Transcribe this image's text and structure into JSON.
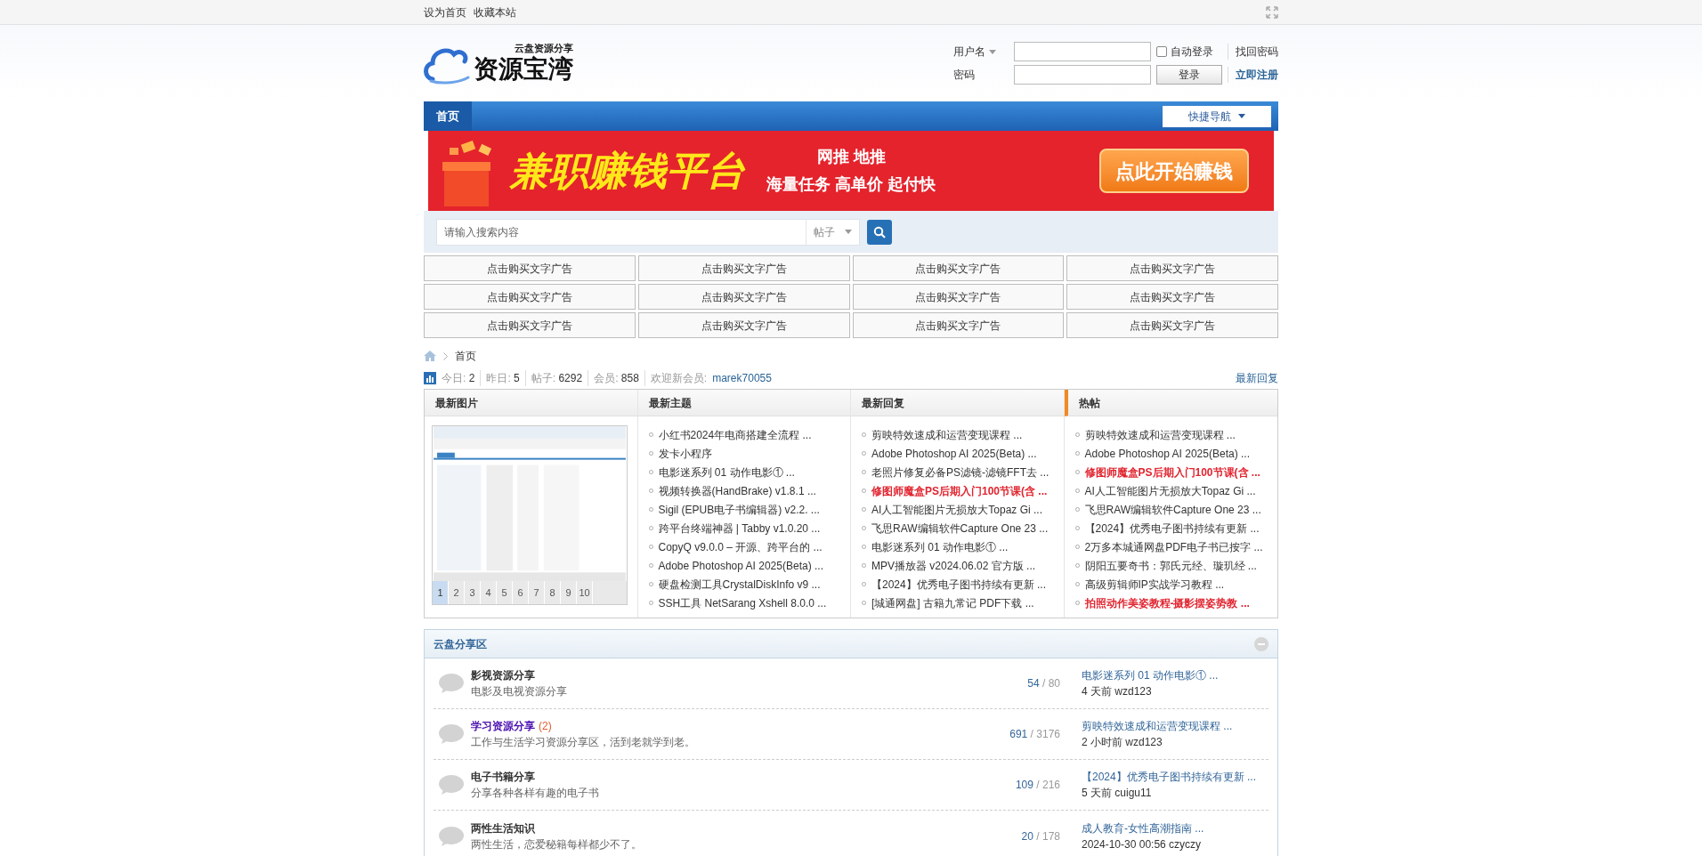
{
  "top_bar": {
    "links": [
      "设为首页",
      "收藏本站"
    ]
  },
  "logo": {
    "name": "资源宝湾",
    "tagline": "云盘资源分享"
  },
  "login": {
    "username_label": "用户名",
    "password_label": "密码",
    "remember": {
      "label": "自动登录",
      "checked": false
    },
    "submit": "登录",
    "forgot": "找回密码",
    "register": "立即注册"
  },
  "nav": {
    "tabs": [
      {
        "label": "首页",
        "selected": true
      }
    ],
    "quick_nav": "快捷导航"
  },
  "banner": {
    "headline": "兼职赚钱平台",
    "line1": "网推 地推",
    "line2": "海量任务 高单价 起付快",
    "cta": "点此开始赚钱"
  },
  "search": {
    "placeholder": "请输入搜索内容",
    "scope": "帖子"
  },
  "text_ads": [
    "点击购买文字广告",
    "点击购买文字广告",
    "点击购买文字广告",
    "点击购买文字广告",
    "点击购买文字广告",
    "点击购买文字广告",
    "点击购买文字广告",
    "点击购买文字广告",
    "点击购买文字广告",
    "点击购买文字广告",
    "点击购买文字广告",
    "点击购买文字广告"
  ],
  "breadcrumb": [
    "首页"
  ],
  "stats": {
    "items": [
      {
        "label": "今日:",
        "value": "2"
      },
      {
        "label": "昨日:",
        "value": "5"
      },
      {
        "label": "帖子:",
        "value": "6292"
      },
      {
        "label": "会员:",
        "value": "858"
      }
    ],
    "welcome_label": "欢迎新会员:",
    "new_member": "marek70055",
    "right_link": "最新回复"
  },
  "panels": [
    {
      "kind": "pictures",
      "title": "最新图片",
      "selected": false,
      "pages": [
        {
          "label": "1",
          "selected": true
        },
        {
          "label": "2",
          "selected": false
        },
        {
          "label": "3",
          "selected": false
        },
        {
          "label": "4",
          "selected": false
        },
        {
          "label": "5",
          "selected": false
        },
        {
          "label": "6",
          "selected": false
        },
        {
          "label": "7",
          "selected": false
        },
        {
          "label": "8",
          "selected": false
        },
        {
          "label": "9",
          "selected": false
        },
        {
          "label": "10",
          "selected": false
        }
      ]
    },
    {
      "kind": "list",
      "title": "最新主题",
      "selected": false,
      "items": [
        {
          "text": "小红书2024年电商搭建全流程 ...",
          "hot": false
        },
        {
          "text": "发卡小程序",
          "hot": false
        },
        {
          "text": "电影迷系列 01 动作电影① ...",
          "hot": false
        },
        {
          "text": "视频转换器(HandBrake) v1.8.1 ...",
          "hot": false
        },
        {
          "text": "Sigil (EPUB电子书编辑器) v2.2. ...",
          "hot": false
        },
        {
          "text": "跨平台终端神器 | Tabby v1.0.20 ...",
          "hot": false
        },
        {
          "text": "CopyQ v9.0.0 – 开源、跨平台的 ...",
          "hot": false
        },
        {
          "text": "Adobe Photoshop AI 2025(Beta) ...",
          "hot": false
        },
        {
          "text": "硬盘检测工具CrystalDiskInfo v9 ...",
          "hot": false
        },
        {
          "text": "SSH工具 NetSarang Xshell 8.0.0 ...",
          "hot": false
        }
      ]
    },
    {
      "kind": "list",
      "title": "最新回复",
      "selected": false,
      "items": [
        {
          "text": "剪映特效速成和运营变现课程 ...",
          "hot": false
        },
        {
          "text": "Adobe Photoshop AI 2025(Beta) ...",
          "hot": false
        },
        {
          "text": "老照片修复必备PS滤镜-滤镜FFT去 ...",
          "hot": false
        },
        {
          "text": "修图师魔盒PS后期入门100节课(含 ...",
          "hot": true
        },
        {
          "text": "AI人工智能图片无损放大Topaz Gi ...",
          "hot": false
        },
        {
          "text": "飞思RAW编辑软件Capture One 23 ...",
          "hot": false
        },
        {
          "text": "电影迷系列 01 动作电影① ...",
          "hot": false
        },
        {
          "text": "MPV播放器 v2024.06.02 官方版 ...",
          "hot": false
        },
        {
          "text": "【2024】优秀电子图书持续有更新 ...",
          "hot": false
        },
        {
          "text": "[城通网盘] 古籍九常记 PDF下载 ...",
          "hot": false
        }
      ]
    },
    {
      "kind": "list",
      "title": "热帖",
      "selected": true,
      "items": [
        {
          "text": "剪映特效速成和运营变现课程 ...",
          "hot": false
        },
        {
          "text": "Adobe Photoshop AI 2025(Beta) ...",
          "hot": false
        },
        {
          "text": "修图师魔盒PS后期入门100节课(含 ...",
          "hot": true
        },
        {
          "text": "AI人工智能图片无损放大Topaz Gi ...",
          "hot": false
        },
        {
          "text": "飞思RAW编辑软件Capture One 23 ...",
          "hot": false
        },
        {
          "text": "【2024】优秀电子图书持续有更新 ...",
          "hot": false
        },
        {
          "text": "2万多本城通网盘PDF电子书已按字 ...",
          "hot": false
        },
        {
          "text": "阴阳五要奇书：郭氏元经、璇玑经 ...",
          "hot": false
        },
        {
          "text": "高级剪辑师IP实战学习教程 ...",
          "hot": false
        },
        {
          "text": "拍照动作美姿教程-摄影摆姿势教 ...",
          "hot": true
        }
      ]
    }
  ],
  "forum": {
    "title": "云盘分享区",
    "count_separator": "/",
    "boards": [
      {
        "name": "影视资源分享",
        "description": "电影及电视资源分享",
        "threads": "54",
        "posts": "80",
        "last_title": "电影迷系列 01 动作电影① ...",
        "last_meta": "4 天前 wzd123"
      },
      {
        "name": "学习资源分享",
        "today": "(2)",
        "description": "工作与生活学习资源分享区，活到老就学到老。",
        "threads": "691",
        "posts": "3176",
        "last_title": "剪映特效速成和运营变现课程 ...",
        "last_meta": "2 小时前 wzd123"
      },
      {
        "name": "电子书籍分享",
        "description": "分享各种各样有趣的电子书",
        "threads": "109",
        "posts": "216",
        "last_title": "【2024】优秀电子图书持续有更新 ...",
        "last_meta": "5 天前 cuigu11"
      },
      {
        "name": "两性生活知识",
        "description": "两性生活，恋爱秘籍每样都少不了。",
        "threads": "20",
        "posts": "178",
        "last_title": "成人教育-女性高潮指南 ...",
        "last_meta": "2024-10-30 00:56 czyczy"
      }
    ]
  }
}
